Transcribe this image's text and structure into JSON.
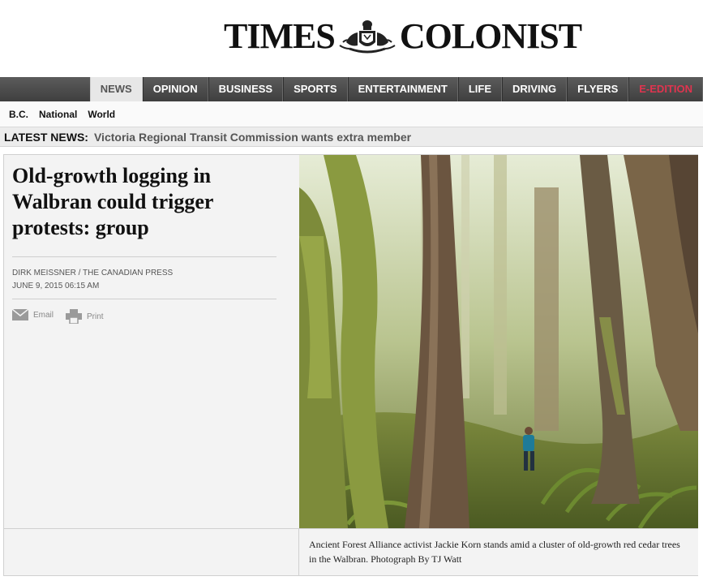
{
  "masthead": {
    "logo_left": "TIMES",
    "logo_right": "COLONIST"
  },
  "nav": {
    "items": [
      {
        "label": "NEWS",
        "active": true
      },
      {
        "label": "OPINION"
      },
      {
        "label": "BUSINESS"
      },
      {
        "label": "SPORTS"
      },
      {
        "label": "ENTERTAINMENT"
      },
      {
        "label": "LIFE"
      },
      {
        "label": "DRIVING"
      },
      {
        "label": "FLYERS"
      },
      {
        "label": "E-EDITION"
      }
    ]
  },
  "subnav": {
    "items": [
      "B.C.",
      "National",
      "World"
    ]
  },
  "latest": {
    "label": "LATEST NEWS:",
    "headline": "Victoria Regional Transit Commission wants extra member"
  },
  "article": {
    "headline": "Old-growth logging in Walbran could trigger protests: group",
    "byline": "DIRK MEISSNER / THE CANADIAN PRESS",
    "dateline": "JUNE 9, 2015 06:15 AM",
    "share_email": "Email",
    "share_print": "Print",
    "caption": "Ancient Forest Alliance activist Jackie Korn stands amid a cluster of old-growth red cedar trees in the Walbran.   Photograph By TJ Watt"
  },
  "colors": {
    "nav_bg": "#4a4a4a",
    "edition_accent": "#e0344f"
  }
}
